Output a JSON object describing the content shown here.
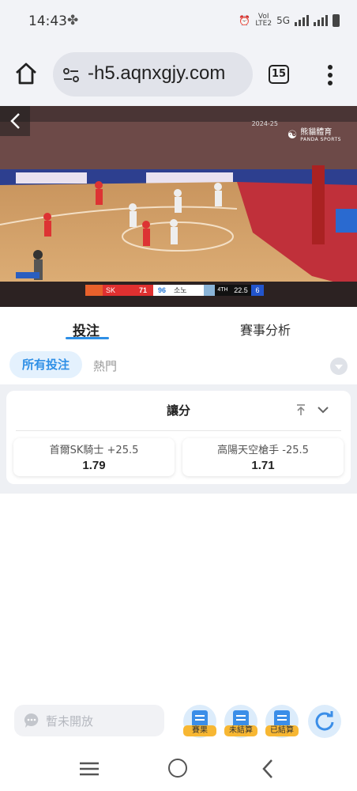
{
  "status_bar": {
    "time": "14:43",
    "network": "5G",
    "volte_top": "VoI",
    "volte_bottom": "LTE2"
  },
  "browser": {
    "url": "-h5.aqnxgjy.com",
    "tab_count": "15"
  },
  "video": {
    "broadcaster_logo": "熊貓體育",
    "broadcaster_sub": "PANDA SPORTS",
    "season": "2024-25",
    "scoreboard": {
      "home_team": "SK",
      "home_score": "71",
      "away_score": "96",
      "away_team": "소노",
      "quarter": "4TH",
      "clock": "22.5",
      "shot_clock": "6"
    }
  },
  "main_tabs": [
    {
      "label": "投注",
      "active": true
    },
    {
      "label": "賽事分析",
      "active": false
    }
  ],
  "filters": {
    "all_bets": "所有投注",
    "hot": "熱門"
  },
  "market": {
    "title": "讓分",
    "options": [
      {
        "team": "首爾SK騎士",
        "handicap": "+25.5",
        "odds": "1.79"
      },
      {
        "team": "高陽天空槍手",
        "handicap": "-25.5",
        "odds": "1.71"
      }
    ]
  },
  "bottom_bar": {
    "chat_placeholder": "暫未開放",
    "results_label": "賽果",
    "unsettled_label": "未結算",
    "settled_label": "已結算"
  },
  "colors": {
    "accent": "#2e8fe6",
    "badge": "#f7b733",
    "home_red": "#e03030"
  }
}
